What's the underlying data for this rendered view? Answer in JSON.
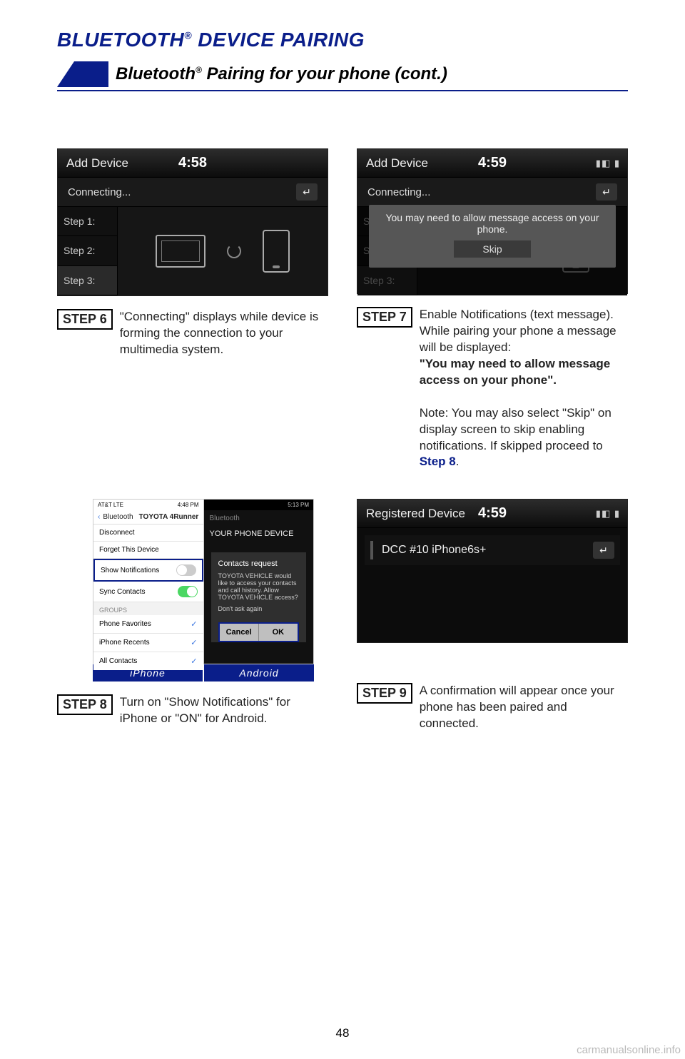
{
  "header": {
    "page_title_prefix": "BLUETOOTH",
    "page_title_suffix": " DEVICE PAIRING",
    "reg": "®",
    "sub_title_prefix": "Bluetooth",
    "sub_title_suffix": " Pairing for your phone (cont.)"
  },
  "screens": {
    "s6": {
      "title": "Add Device",
      "time": "4:58",
      "sub": "Connecting...",
      "steps": [
        "Step 1:",
        "Step 2:",
        "Step 3:"
      ]
    },
    "s7": {
      "title": "Add Device",
      "time": "4:59",
      "sub": "Connecting...",
      "icons": "▮◧ ▮",
      "notice": "You may need to allow message access on your phone.",
      "skip": "Skip"
    },
    "s9": {
      "title": "Registered Device",
      "time": "4:59",
      "icons": "▮◧ ▮",
      "device": "DCC #10 iPhone6s+"
    },
    "s8": {
      "ios": {
        "status_left": "AT&T  LTE",
        "status_right": "4:48 PM",
        "nav_back": "Bluetooth",
        "nav_title": "TOYOTA 4Runner",
        "rows": {
          "disconnect": "Disconnect",
          "forget": "Forget This Device",
          "show_notif": "Show Notifications",
          "sync": "Sync Contacts",
          "group": "GROUPS",
          "fav": "Phone Favorites",
          "recents": "iPhone Recents",
          "all": "All Contacts"
        }
      },
      "android": {
        "status_right": "5:13 PM",
        "head": "Bluetooth",
        "sub": "YOUR PHONE DEVICE",
        "dlg_title": "Contacts request",
        "dlg_body": "TOYOTA VEHICLE would like to access your contacts and call history. Allow TOYOTA VEHICLE access?",
        "dlg_check": "Don't ask again",
        "btn_cancel": "Cancel",
        "btn_ok": "OK"
      },
      "tabs": {
        "iphone": "iPhone",
        "android": "Android"
      }
    }
  },
  "steps": {
    "s6": {
      "label": "STEP 6",
      "text": "\"Connecting\" displays while device is forming the connection to your multimedia system."
    },
    "s7": {
      "label": "STEP 7",
      "p1": "Enable Notifications (text message). While pairing your phone a message will be displayed:",
      "bold": "\"You may need to allow message access on your phone\".",
      "note_prefix": "Note: You may also select \"Skip\" on display screen to skip enabling notifications. If skipped proceed to ",
      "note_link": "Step 8",
      "note_suffix": "."
    },
    "s8": {
      "label": "STEP 8",
      "text": "Turn on \"Show Notifications\" for iPhone or \"ON\" for Android."
    },
    "s9": {
      "label": "STEP 9",
      "text": "A confirmation will appear once your phone has been paired and connected."
    }
  },
  "footer": {
    "page_num": "48",
    "watermark": "carmanualsonline.info"
  }
}
